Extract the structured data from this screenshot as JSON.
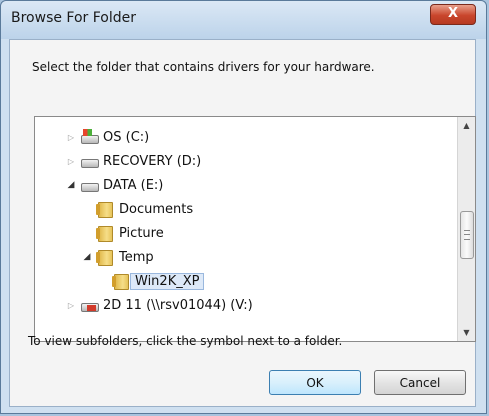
{
  "window": {
    "title": "Browse For Folder",
    "close_glyph": "X"
  },
  "instruction": "Select the folder that contains drivers for your hardware.",
  "tree": [
    {
      "label": "OS (C:)",
      "icon": "os-drive-icon",
      "expander": "▷",
      "expanded": false
    },
    {
      "label": "RECOVERY (D:)",
      "icon": "drive-icon",
      "expander": "▷",
      "expanded": false
    },
    {
      "label": "DATA (E:)",
      "icon": "drive-icon",
      "expander": "◢",
      "expanded": true
    },
    {
      "label": "Documents",
      "icon": "folder-icon",
      "expander": "",
      "expanded": false
    },
    {
      "label": "Picture",
      "icon": "folder-icon",
      "expander": "",
      "expanded": false
    },
    {
      "label": "Temp",
      "icon": "folder-icon",
      "expander": "◢",
      "expanded": true
    },
    {
      "label": "Win2K_XP",
      "icon": "folder-icon",
      "expander": "",
      "selected": true
    },
    {
      "label": "2D 11 (\\\\rsv01044) (V:)",
      "icon": "network-drive-icon",
      "expander": "▷",
      "expanded": false
    }
  ],
  "scrollbar": {
    "up_glyph": "▲",
    "down_glyph": "▼"
  },
  "hint": "To view subfolders, click the symbol next to a folder.",
  "buttons": {
    "ok": "OK",
    "cancel": "Cancel"
  }
}
